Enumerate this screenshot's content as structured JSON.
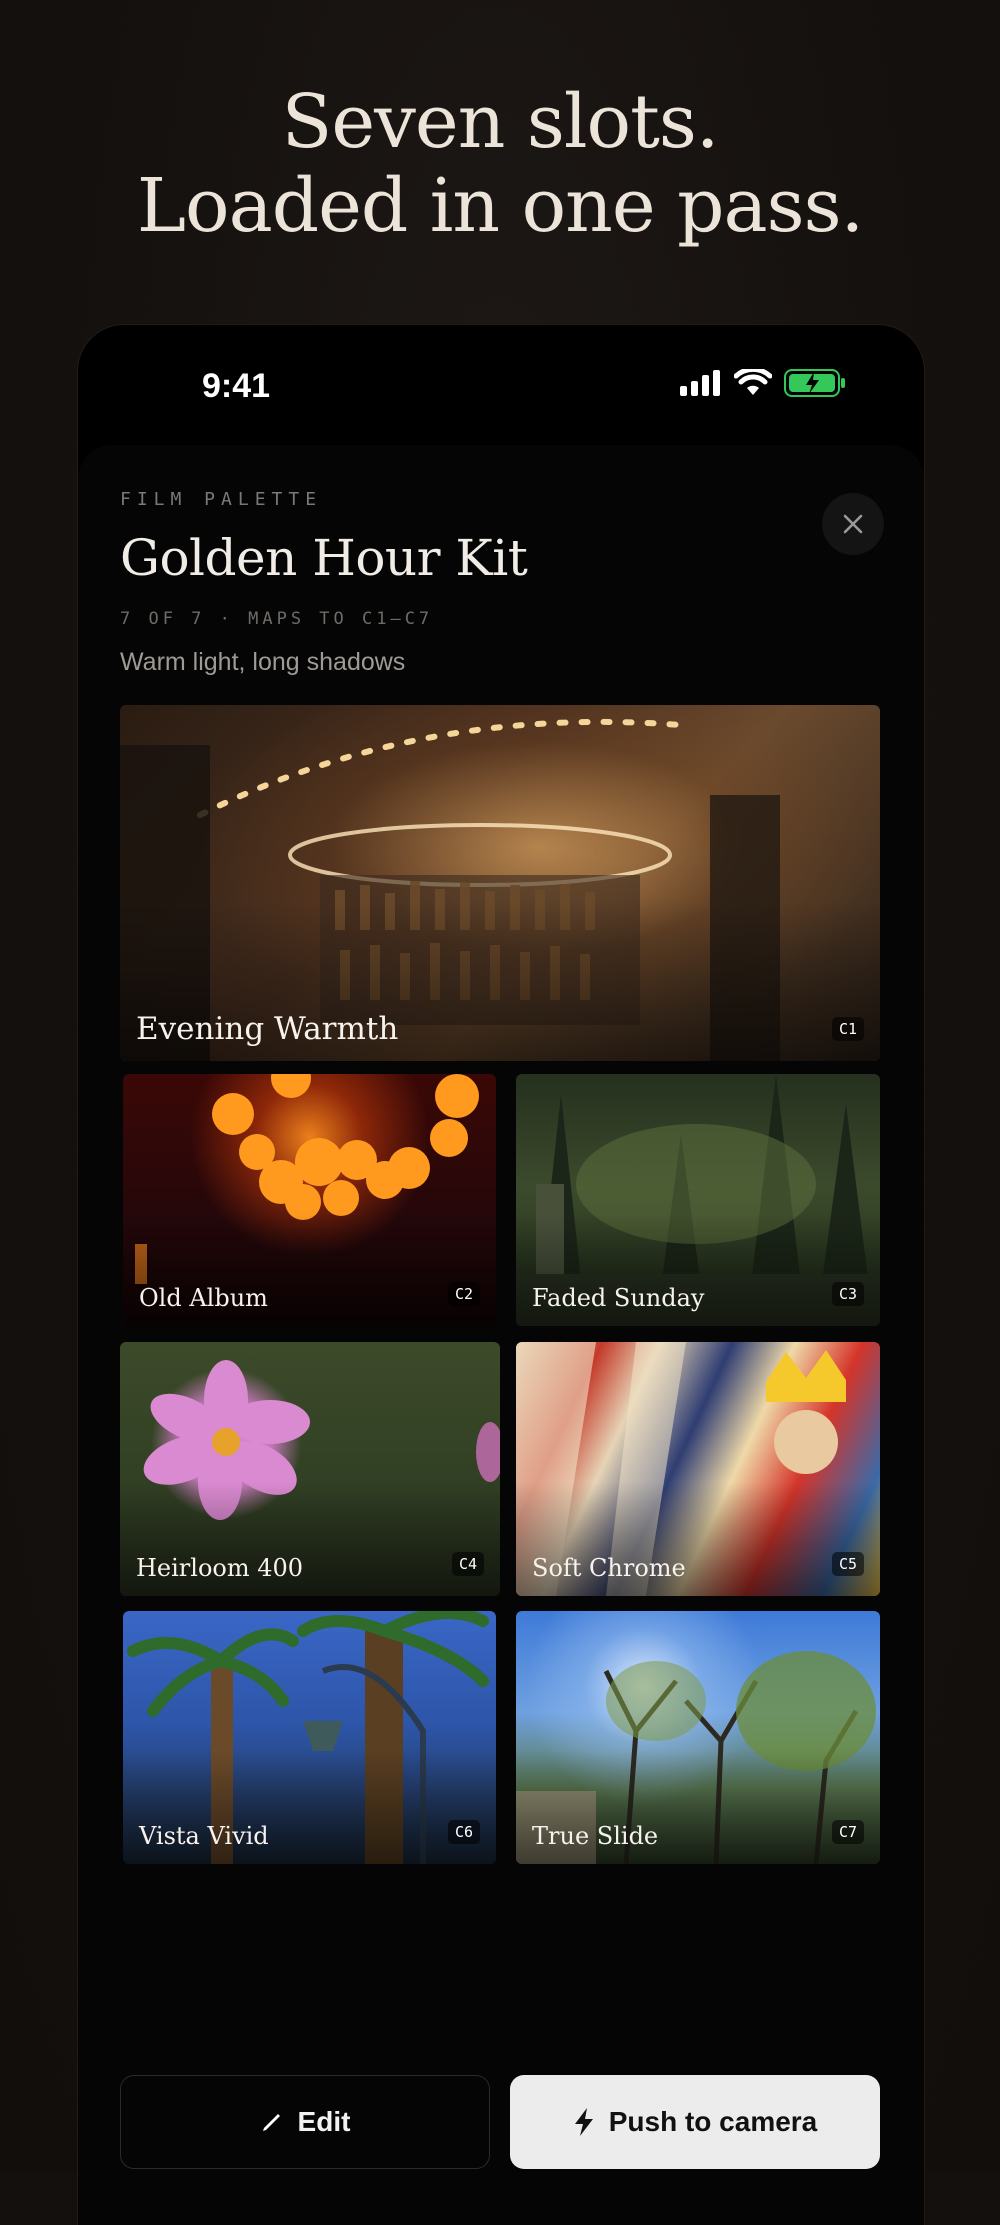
{
  "headline": {
    "line1": "Seven slots.",
    "line2": "Loaded in one pass."
  },
  "status_bar": {
    "time": "9:41",
    "icons": [
      "signal-icon",
      "wifi-icon",
      "battery-charging-icon"
    ],
    "battery_color": "#34c759"
  },
  "sheet": {
    "eyebrow": "FILM PALETTE",
    "title": "Golden Hour Kit",
    "meta": "7 OF 7 · MAPS TO C1–C7",
    "description": "Warm light, long shadows",
    "close_icon": "close-icon"
  },
  "slots": [
    {
      "name": "Evening Warmth",
      "code": "C1"
    },
    {
      "name": "Old Album",
      "code": "C2"
    },
    {
      "name": "Faded Sunday",
      "code": "C3"
    },
    {
      "name": "Heirloom 400",
      "code": "C4"
    },
    {
      "name": "Soft Chrome",
      "code": "C5"
    },
    {
      "name": "Vista Vivid",
      "code": "C6"
    },
    {
      "name": "True Slide",
      "code": "C7"
    }
  ],
  "actions": {
    "edit_label": "Edit",
    "edit_icon": "pencil-icon",
    "push_label": "Push to camera",
    "push_icon": "bolt-icon"
  }
}
